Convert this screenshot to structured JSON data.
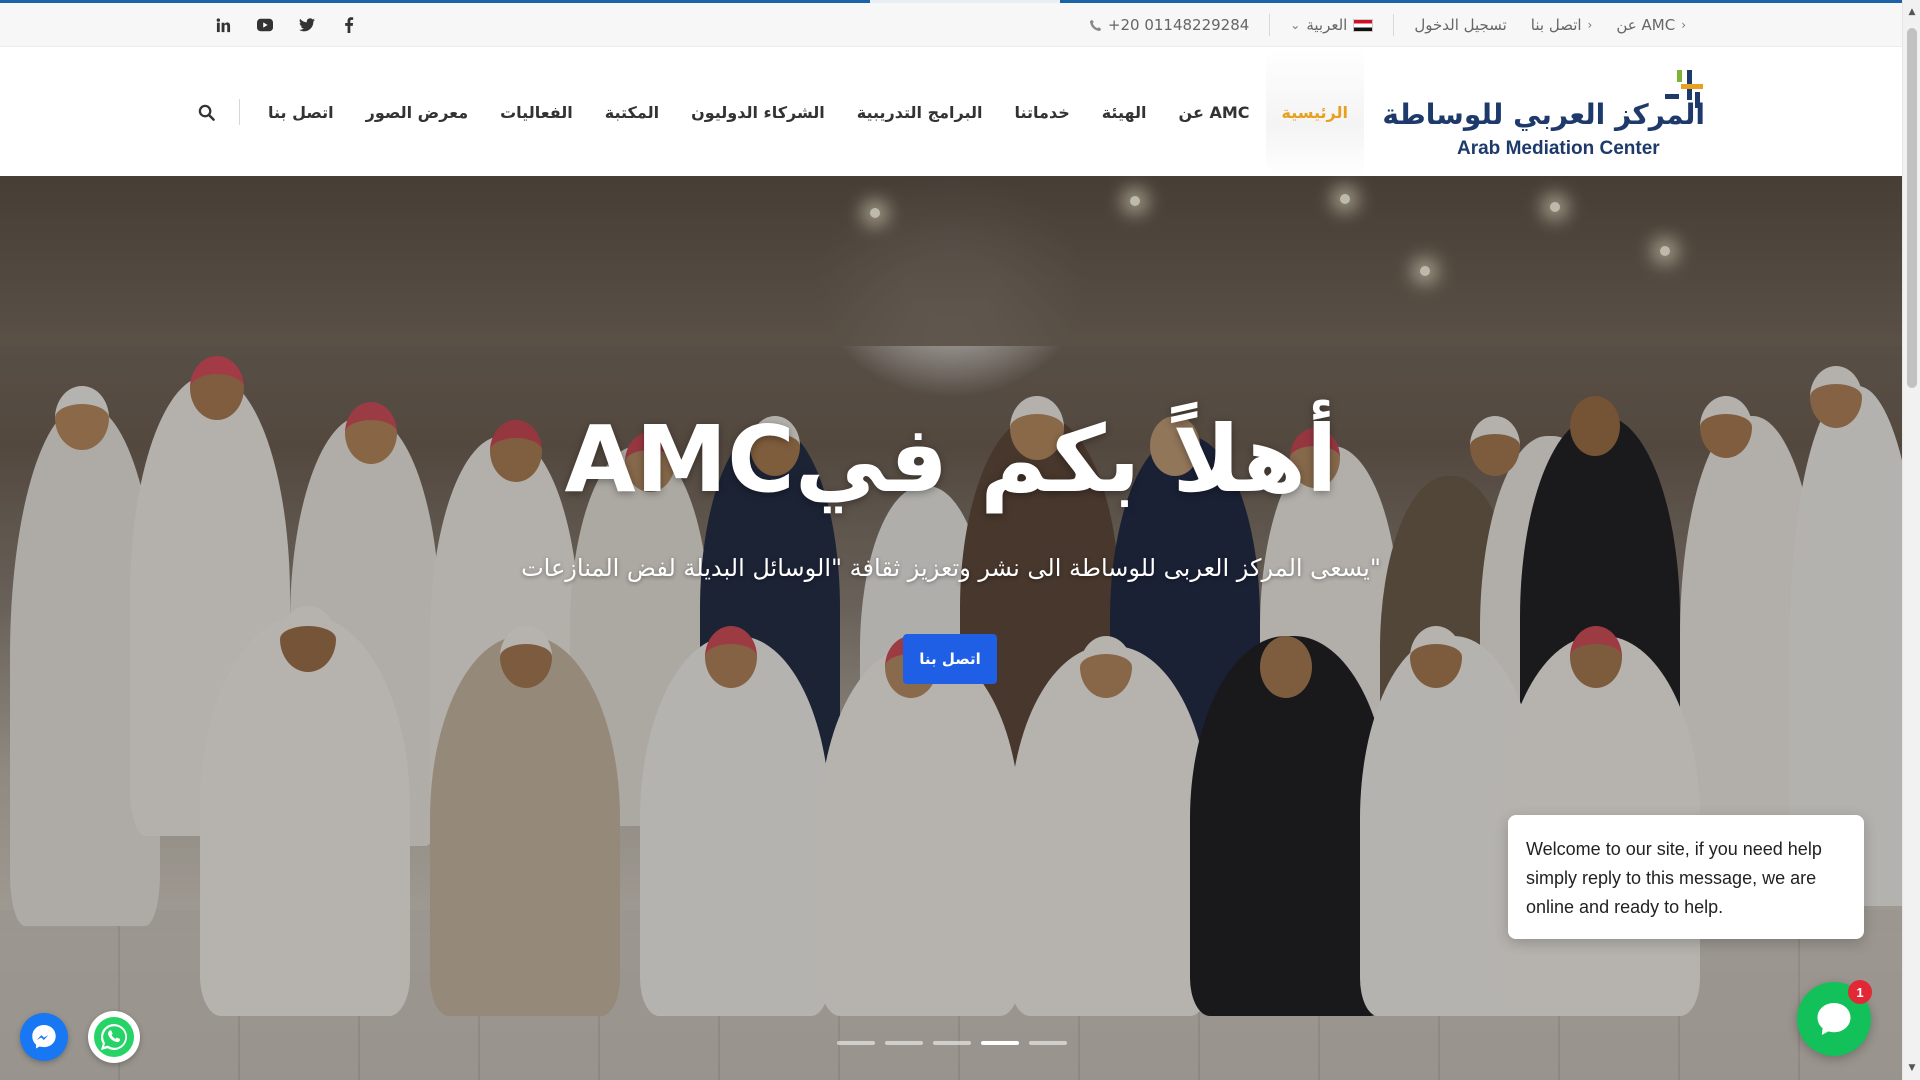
{
  "topbar": {
    "social_icons": [
      "linkedin-icon",
      "youtube-icon",
      "twitter-icon",
      "facebook-icon"
    ],
    "phone": "+20 01148229284",
    "language": "العربية",
    "login": "تسجيل الدخول",
    "contact": "اتصل بنا",
    "about": "عن AMC"
  },
  "header": {
    "logo_ar": "المركز العربي للوساطة",
    "logo_en": "Arab Mediation Center",
    "nav": [
      {
        "label": "الرئيسية",
        "active": true
      },
      {
        "label": "عن AMC"
      },
      {
        "label": "الهيئة"
      },
      {
        "label": "خدماتنا"
      },
      {
        "label": "البرامج التدريبية"
      },
      {
        "label": "الشركاء الدوليون"
      },
      {
        "label": "المكتبة"
      },
      {
        "label": "الفعاليات"
      },
      {
        "label": "معرض الصور"
      },
      {
        "label": "اتصل بنا"
      }
    ],
    "search_icon": "search-icon"
  },
  "hero": {
    "title": "أهلاً بكم فيAMC",
    "subtitle": "\"يسعى المركز العربى للوساطة الى نشر وتعزيز ثقافة \"الوسائل البديلة لفض المنازعات",
    "cta": "اتصل بنا",
    "slides_total": 5,
    "active_slide": 4
  },
  "chat": {
    "message": "Welcome to our site, if you need help simply reply to this message, we are online and ready to help.",
    "badge": "1"
  },
  "colors": {
    "accent_line": "#1a63a8",
    "active_nav": "#e8a020",
    "cta": "#1f5fe6",
    "chat_green": "#13c15a",
    "logo_navy": "#1e3a6b"
  }
}
